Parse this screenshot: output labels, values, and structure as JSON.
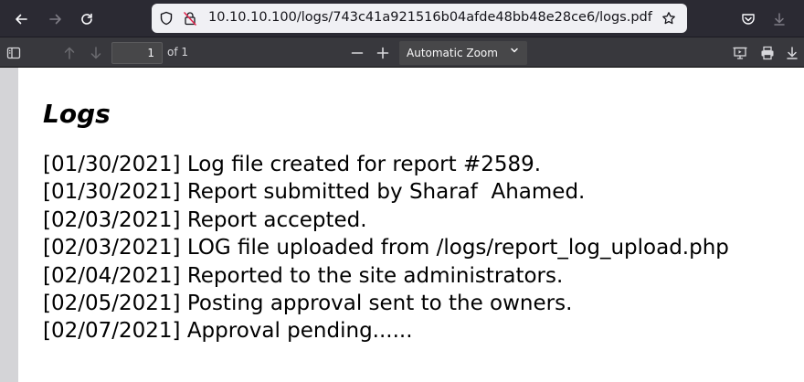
{
  "browser": {
    "url": "10.10.10.100/logs/743c41a921516b04afde48bb48e28ce6/logs.pdf",
    "icons": {
      "back": "arrow-left-icon",
      "forward": "arrow-right-icon",
      "reload": "reload-icon",
      "site_info": "shield-icon",
      "insecure": "insecure-lock-icon",
      "bookmark": "star-icon",
      "pocket": "pocket-icon",
      "downloads": "download-icon"
    }
  },
  "pdf_toolbar": {
    "current_page": "1",
    "page_count_label": "of 1",
    "zoom_label": "Automatic Zoom",
    "icons": {
      "sidebar": "sidebar-toggle-icon",
      "prev_page": "arrow-up-icon",
      "next_page": "arrow-down-icon",
      "zoom_out": "minus-icon",
      "zoom_in": "plus-icon",
      "presentation": "presentation-icon",
      "print": "print-icon",
      "save": "download-icon"
    }
  },
  "document": {
    "title": "Logs",
    "lines": [
      "[01/30/2021] Log file created for report #2589.",
      "[01/30/2021] Report submitted by Sharaf  Ahamed.",
      "[02/03/2021] Report accepted.",
      "[02/03/2021] LOG file uploaded from /logs/report_log_upload.php",
      "[02/04/2021] Reported to the site administrators.",
      "[02/05/2021] Posting approval sent to the owners.",
      "[02/07/2021] Approval pending......"
    ]
  }
}
